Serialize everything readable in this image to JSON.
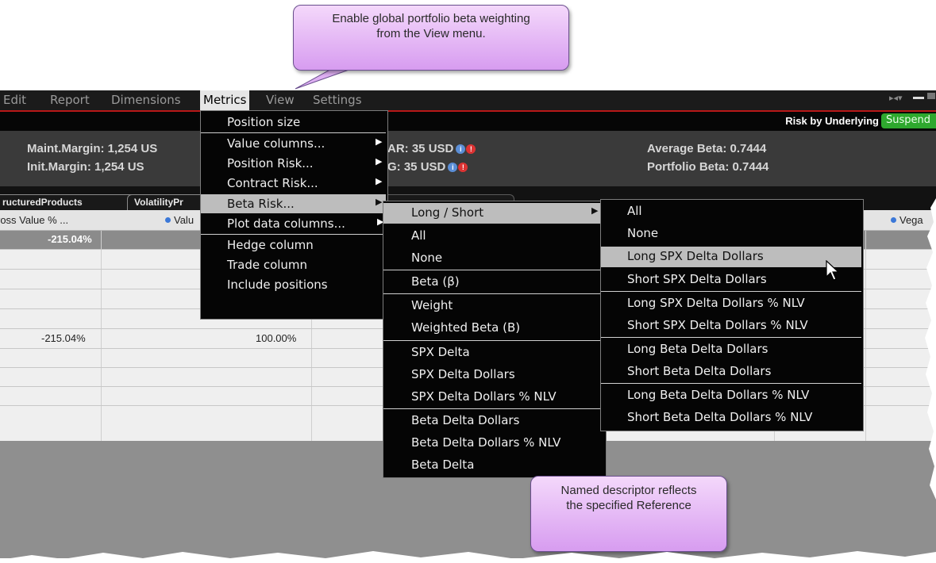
{
  "callouts": {
    "top_line1": "Enable global portfolio beta weighting",
    "top_line2": "from the View menu.",
    "bottom_line1": "Named descriptor reflects",
    "bottom_line2": "the specified Reference"
  },
  "menubar": {
    "items": [
      "Edit",
      "Report",
      "Dimensions",
      "Metrics",
      "View",
      "Settings"
    ],
    "active": "Metrics"
  },
  "titlebar": {
    "risk_label": "Risk by Underlying",
    "suspend_label": "Suspend"
  },
  "summary": {
    "maint_margin": "Maint.Margin: 1,254 US",
    "init_margin": "Init.Margin:     1,254 US",
    "var_label": "AR:",
    "var_value": "35 USD",
    "g_label": "G:",
    "g_value": "35 USD",
    "average_beta": "Average Beta: 0.7444",
    "portfolio_beta": "Portfolio Beta: 0.7444"
  },
  "tabs": [
    "ructuredProducts",
    "VolatilityPr"
  ],
  "columns": {
    "gross_value": "ross Value % ...",
    "value": "Valu",
    "vega": "Vega"
  },
  "grid": {
    "total_gross": "-215.04%",
    "row5_gross": "-215.04%",
    "row5_value": "100.00%"
  },
  "metrics_menu": [
    {
      "label": "Position size",
      "submenu": false
    },
    {
      "label": "Value columns...",
      "submenu": true
    },
    {
      "label": "Position Risk...",
      "submenu": true
    },
    {
      "label": "Contract Risk...",
      "submenu": true
    },
    {
      "label": "Beta Risk...",
      "submenu": true,
      "highlighted": true
    },
    {
      "label": "Plot data columns...",
      "submenu": true
    },
    {
      "label": "Hedge column",
      "submenu": false
    },
    {
      "label": "Trade column",
      "submenu": false
    },
    {
      "label": "Include positions",
      "submenu": false
    }
  ],
  "beta_menu": [
    {
      "label": "Long / Short",
      "submenu": true,
      "highlighted": true
    },
    {
      "label": "All"
    },
    {
      "label": "None"
    },
    {
      "label": "Beta (β)"
    },
    {
      "label": "Weight"
    },
    {
      "label": "Weighted Beta (B)"
    },
    {
      "label": "SPX Delta"
    },
    {
      "label": "SPX Delta Dollars"
    },
    {
      "label": "SPX Delta Dollars % NLV"
    },
    {
      "label": "Beta Delta Dollars"
    },
    {
      "label": "Beta Delta Dollars % NLV"
    },
    {
      "label": "Beta Delta"
    }
  ],
  "longshort_menu": [
    {
      "label": "All"
    },
    {
      "label": "None"
    },
    {
      "label": "Long SPX Delta Dollars",
      "highlighted": true
    },
    {
      "label": "Short SPX Delta Dollars"
    },
    {
      "label": "Long SPX Delta Dollars % NLV"
    },
    {
      "label": "Short SPX Delta Dollars % NLV"
    },
    {
      "label": "Long Beta Delta Dollars"
    },
    {
      "label": "Short Beta Delta Dollars"
    },
    {
      "label": "Long Beta Delta Dollars % NLV"
    },
    {
      "label": "Short Beta Delta Dollars % NLV"
    }
  ],
  "icons": {
    "submenu_arrow": "triangle-right-icon",
    "info": "info-icon",
    "warning": "warning-icon",
    "cursor": "mouse-pointer-icon"
  }
}
